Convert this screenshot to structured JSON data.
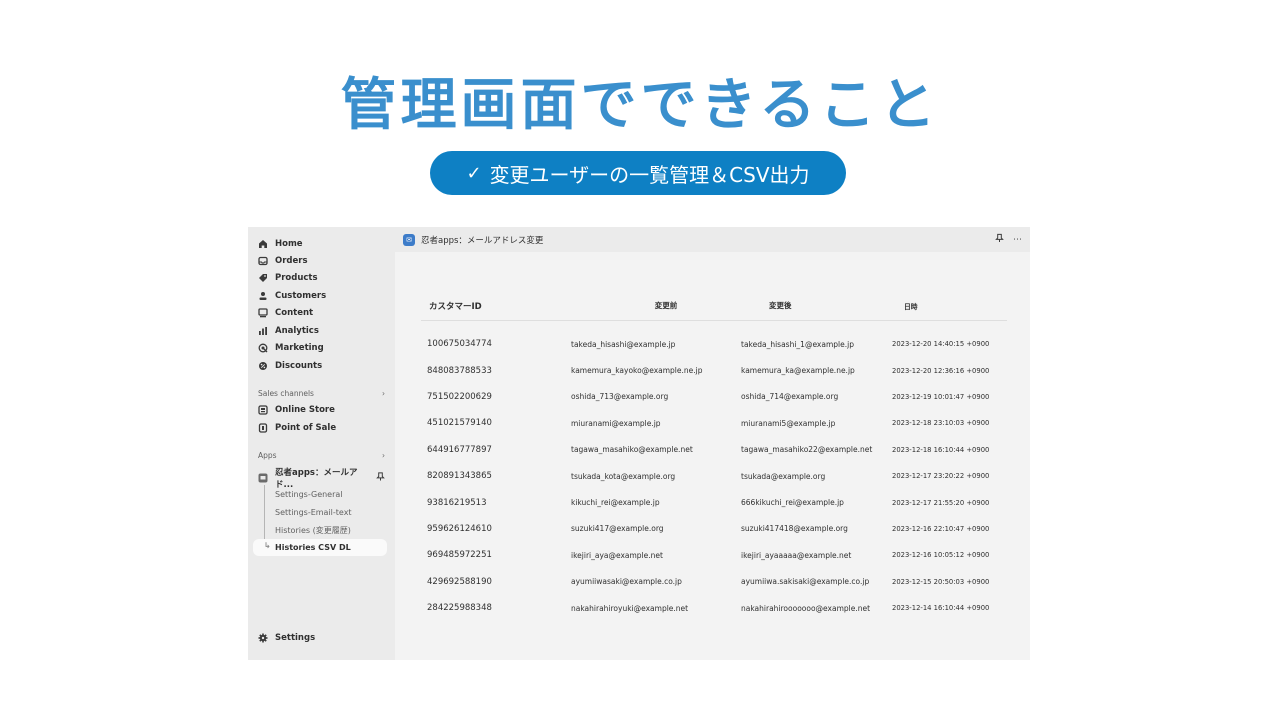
{
  "headline": "管理画面でできること",
  "feature_pill": {
    "check_icon": "✓",
    "label": "変更ユーザーの一覧管理＆CSV出力"
  },
  "topbar": {
    "app_title": "忍者apps：メールアドレス変更",
    "pin_icon": "pin-icon",
    "more_icon": "⋯"
  },
  "sidebar": {
    "nav": [
      {
        "label": "Home",
        "icon": "home-icon"
      },
      {
        "label": "Orders",
        "icon": "inbox-icon"
      },
      {
        "label": "Products",
        "icon": "tag-icon"
      },
      {
        "label": "Customers",
        "icon": "person-icon"
      },
      {
        "label": "Content",
        "icon": "content-icon"
      },
      {
        "label": "Analytics",
        "icon": "bar-chart-icon"
      },
      {
        "label": "Marketing",
        "icon": "target-icon"
      },
      {
        "label": "Discounts",
        "icon": "discount-icon"
      }
    ],
    "sales_channels": {
      "label": "Sales channels",
      "items": [
        {
          "label": "Online Store",
          "icon": "store-icon"
        },
        {
          "label": "Point of Sale",
          "icon": "pos-icon"
        }
      ]
    },
    "apps": {
      "label": "Apps",
      "app_name": "忍者apps：メールアド...",
      "sub_items": [
        {
          "label": "Settings-General"
        },
        {
          "label": "Settings-Email-text"
        },
        {
          "label": "Histories (変更履歴)"
        },
        {
          "label": "Histories CSV DL",
          "active": true
        }
      ]
    },
    "settings": "Settings"
  },
  "table": {
    "headers": [
      "カスタマーID",
      "変更前",
      "変更後",
      "日時"
    ],
    "rows": [
      [
        "100675034774",
        "takeda_hisashi@example.jp",
        "takeda_hisashi_1@example.jp",
        "2023-12-20 14:40:15 +0900"
      ],
      [
        "848083788533",
        "kamemura_kayoko@example.ne.jp",
        "kamemura_ka@example.ne.jp",
        "2023-12-20 12:36:16 +0900"
      ],
      [
        "751502200629",
        "oshida_713@example.org",
        "oshida_714@example.org",
        "2023-12-19 10:01:47 +0900"
      ],
      [
        "451021579140",
        "miuranami@example.jp",
        "miuranami5@example.jp",
        "2023-12-18 23:10:03 +0900"
      ],
      [
        "644916777897",
        "tagawa_masahiko@example.net",
        "tagawa_masahiko22@example.net",
        "2023-12-18 16:10:44 +0900"
      ],
      [
        "820891343865",
        "tsukada_kota@example.org",
        "tsukada@example.org",
        "2023-12-17 23:20:22 +0900"
      ],
      [
        "93816219513",
        "kikuchi_rei@example.jp",
        "666kikuchi_rei@example.jp",
        "2023-12-17 21:55:20 +0900"
      ],
      [
        "959626124610",
        "suzuki417@example.org",
        "suzuki417418@example.org",
        "2023-12-16 22:10:47 +0900"
      ],
      [
        "969485972251",
        "ikejiri_aya@example.net",
        "ikejiri_ayaaaaa@example.net",
        "2023-12-16 10:05:12 +0900"
      ],
      [
        "429692588190",
        "ayumiiwasaki@example.co.jp",
        "ayumiiwa.sakisaki@example.co.jp",
        "2023-12-15 20:50:03 +0900"
      ],
      [
        "284225988348",
        "nakahirahiroyuki@example.net",
        "nakahirahirooooooo@example.net",
        "2023-12-14 16:10:44 +0900"
      ]
    ]
  }
}
